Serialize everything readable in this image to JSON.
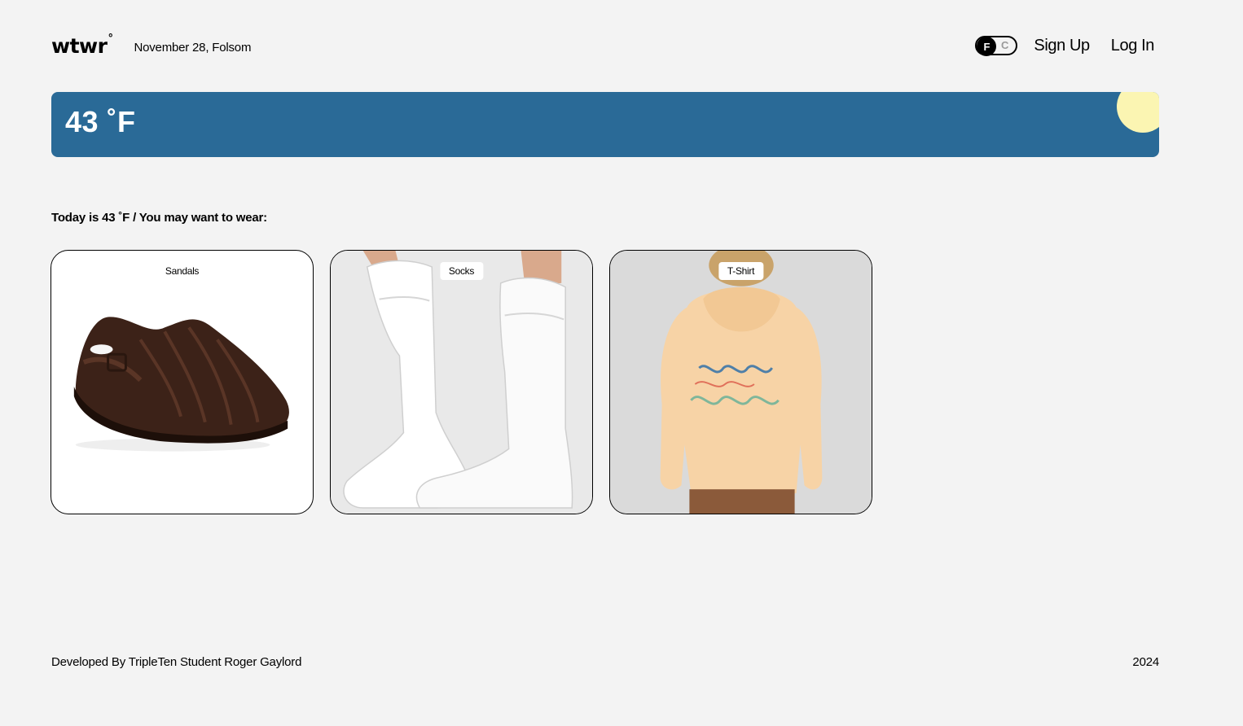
{
  "header": {
    "logo": "wtwr",
    "logo_degree": "°",
    "date_location": "November 28, Folsom",
    "toggle": {
      "active": "F",
      "inactive": "C"
    },
    "sign_up": "Sign Up",
    "log_in": "Log In"
  },
  "weather": {
    "temperature": "43 ˚F",
    "colors": {
      "banner": "#2a6a97",
      "sun": "#fbf5b2"
    }
  },
  "message": "Today is 43 ˚F / You may want to wear:",
  "items": [
    {
      "label": "Sandals"
    },
    {
      "label": "Socks"
    },
    {
      "label": "T-Shirt"
    }
  ],
  "footer": {
    "credit": "Developed By TripleTen Student Roger Gaylord",
    "year": "2024"
  }
}
